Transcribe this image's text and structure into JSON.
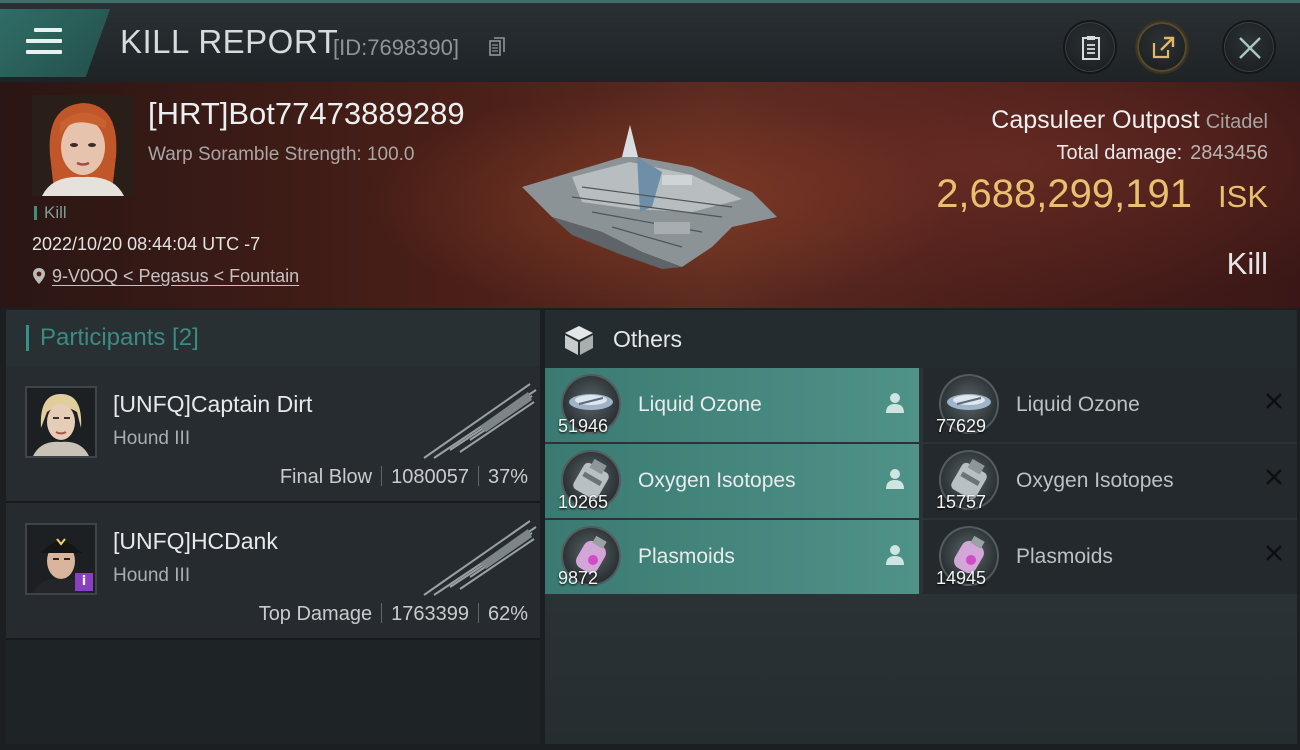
{
  "header": {
    "title": "KILL REPORT",
    "report_id": "[ID:7698390]"
  },
  "victim": {
    "name": "[HRT]Bot77473889289",
    "scramble": "Warp Soramble Strength: 100.0",
    "tag": "Kill",
    "timestamp": "2022/10/20 08:44:04 UTC -7",
    "location": "9-V0OQ < Pegasus < Fountain",
    "structure": "Capsuleer Outpost",
    "structure_class": "Citadel",
    "total_damage_label": "Total damage:",
    "total_damage": "2843456",
    "isk_value": "2,688,299,191",
    "isk_unit": "ISK",
    "result": "Kill"
  },
  "participants": {
    "title": "Participants [2]",
    "list": [
      {
        "name": "[UNFQ]Captain Dirt",
        "ship": "Hound III",
        "role": "Final Blow",
        "damage": "1080057",
        "percent": "37%"
      },
      {
        "name": "[UNFQ]HCDank",
        "ship": "Hound III",
        "role": "Top Damage",
        "damage": "1763399",
        "percent": "62%"
      }
    ]
  },
  "others": {
    "title": "Others",
    "items": [
      {
        "name": "Liquid Ozone",
        "qty": "51946",
        "status": "owned"
      },
      {
        "name": "Liquid Ozone",
        "qty": "77629",
        "status": "dropped"
      },
      {
        "name": "Oxygen Isotopes",
        "qty": "10265",
        "status": "owned"
      },
      {
        "name": "Oxygen Isotopes",
        "qty": "15757",
        "status": "dropped"
      },
      {
        "name": "Plasmoids",
        "qty": "9872",
        "status": "owned"
      },
      {
        "name": "Plasmoids",
        "qty": "14945",
        "status": "dropped"
      }
    ]
  },
  "colors": {
    "accent_teal": "#3b8f84",
    "isk_gold": "#e9bf70"
  }
}
